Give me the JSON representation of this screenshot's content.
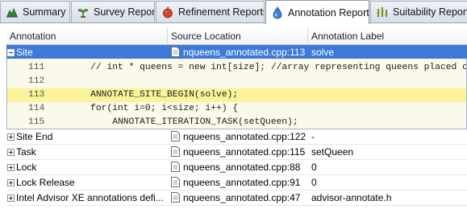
{
  "tabs": [
    {
      "label": "Summary",
      "icon": "summary-icon",
      "active": false
    },
    {
      "label": "Survey Report",
      "icon": "survey-icon",
      "active": false
    },
    {
      "label": "Refinement Reports",
      "icon": "refinement-icon",
      "active": false
    },
    {
      "label": "Annotation Report",
      "icon": "droplet-icon",
      "active": true
    },
    {
      "label": "Suitability Report",
      "icon": "suitability-icon",
      "active": false
    }
  ],
  "columns": {
    "annotation": "Annotation",
    "source_location": "Source Location",
    "annotation_label": "Annotation Label"
  },
  "rows": [
    {
      "annotation": "Site",
      "source": "nqueens_annotated.cpp:113",
      "label": "solve",
      "expanded": true,
      "selected": true
    },
    {
      "annotation": "Site End",
      "source": "nqueens_annotated.cpp:122",
      "label": "-"
    },
    {
      "annotation": "Task",
      "source": "nqueens_annotated.cpp:115",
      "label": "setQueen"
    },
    {
      "annotation": "Lock",
      "source": "nqueens_annotated.cpp:88",
      "label": "0"
    },
    {
      "annotation": "Lock Release",
      "source": "nqueens_annotated.cpp:91",
      "label": "0"
    },
    {
      "annotation": "Intel Advisor XE annotations defi...",
      "source": "nqueens_annotated.cpp:47",
      "label": "advisor-annotate.h"
    }
  ],
  "source_lines": [
    {
      "num": "111",
      "code": "    // int * queens = new int[size]; //array representing queens placed o",
      "highlight": false
    },
    {
      "num": "112",
      "code": "",
      "highlight": false
    },
    {
      "num": "113",
      "code": "    ANNOTATE_SITE_BEGIN(solve);",
      "highlight": true
    },
    {
      "num": "114",
      "code": "    for(int i=0; i<size; i++) {",
      "highlight": false
    },
    {
      "num": "115",
      "code": "        ANNOTATE_ITERATION_TASK(setQueen);",
      "highlight": false
    }
  ],
  "colors": {
    "selection": "#3d7ad8",
    "source_background": "#fbf9e9",
    "source_highlight": "#fbf39a"
  }
}
